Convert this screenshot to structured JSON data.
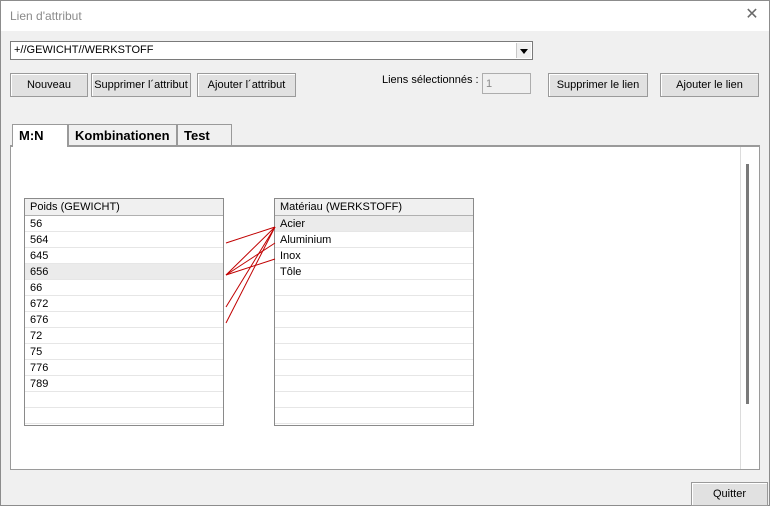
{
  "window": {
    "title": "Lien d'attribut"
  },
  "combo": {
    "value": "+//GEWICHT//WERKSTOFF"
  },
  "toolbar": {
    "new_label": "Nouveau",
    "delete_attr_label": "Supprimer l´attribut",
    "add_attr_label": "Ajouter l´attribut",
    "selected_links_label": "Liens sélectionnés :",
    "selected_links_value": "1",
    "delete_link_label": "Supprimer le lien",
    "add_link_label": "Ajouter le lien"
  },
  "tabs": [
    {
      "label": "M:N"
    },
    {
      "label": "Kombinationen"
    },
    {
      "label": "Test"
    }
  ],
  "left_list": {
    "header": "Poids (GEWICHT)",
    "rows": [
      "56",
      "564",
      "645",
      "656",
      "66",
      "672",
      "676",
      "72",
      "75",
      "776",
      "789",
      "",
      ""
    ]
  },
  "right_list": {
    "header": "Matériau (WERKSTOFF)",
    "rows": [
      "Acier",
      "Aluminium",
      "Inox",
      "Tôle",
      "",
      "",
      "",
      "",
      "",
      "",
      "",
      "",
      ""
    ]
  },
  "links": [
    {
      "from": "564",
      "to": "Acier"
    },
    {
      "from": "656",
      "to": "Acier"
    },
    {
      "from": "656",
      "to": "Aluminium"
    },
    {
      "from": "656",
      "to": "Inox"
    },
    {
      "from": "672",
      "to": "Acier"
    },
    {
      "from": "676",
      "to": "Acier"
    }
  ],
  "link_color": "#c00000",
  "footer": {
    "quit_label": "Quitter"
  }
}
